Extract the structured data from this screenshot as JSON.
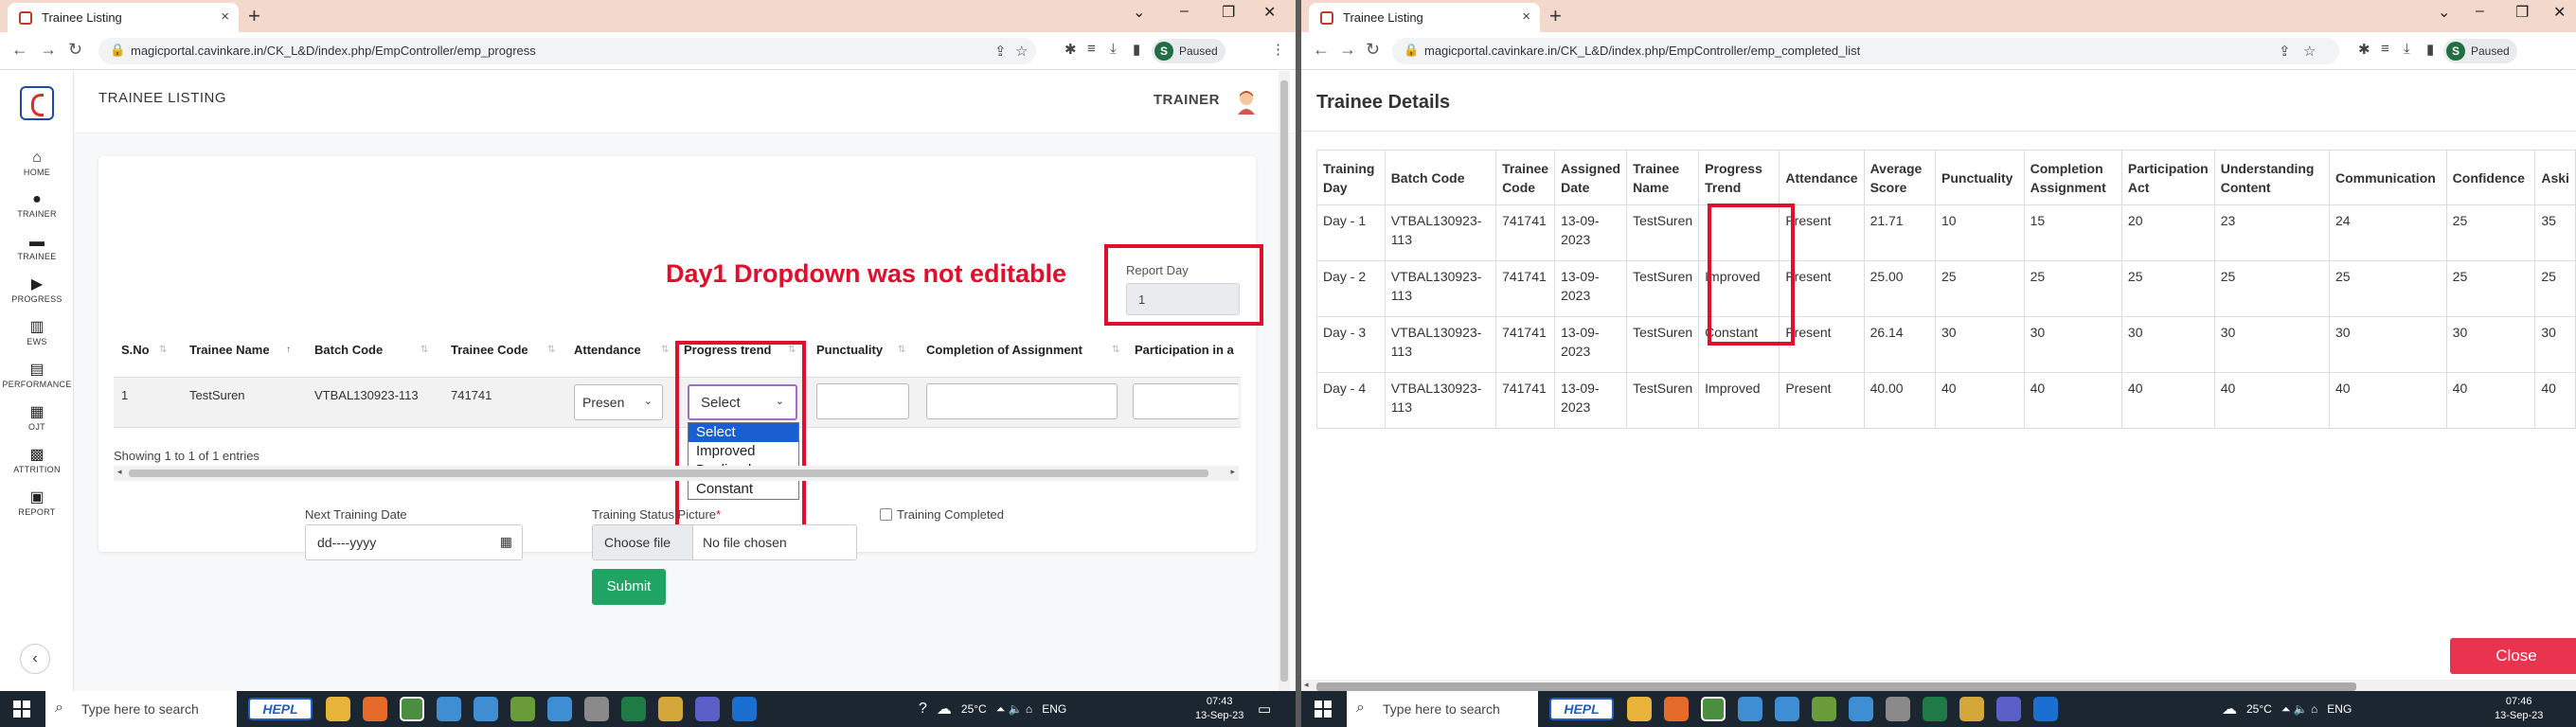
{
  "left": {
    "tab_title": "Trainee Listing",
    "url": "magicportal.cavinkare.in/CK_L&D/index.php/EmpController/emp_progress",
    "profile_initial": "S",
    "profile_status": "Paused",
    "header_role": "TRAINER",
    "page_title": "TRAINEE LISTING",
    "sidebar": [
      {
        "icon": "home-icon",
        "label": "HOME"
      },
      {
        "icon": "trainer-icon",
        "label": "TRAINER"
      },
      {
        "icon": "trainee-icon",
        "label": "TRAINEE"
      },
      {
        "icon": "progress-icon",
        "label": "PROGRESS"
      },
      {
        "icon": "ews-icon",
        "label": "EWS"
      },
      {
        "icon": "performance-icon",
        "label": "PERFORMANCE"
      },
      {
        "icon": "ojt-icon",
        "label": "OJT"
      },
      {
        "icon": "attrition-icon",
        "label": "ATTRITION"
      },
      {
        "icon": "report-icon",
        "label": "REPORT"
      }
    ],
    "annotation": "Day1 Dropdown was not editable",
    "report_day_label": "Report Day",
    "report_day_value": "1",
    "columns": [
      "S.No",
      "Trainee Name",
      "Batch Code",
      "Trainee Code",
      "Attendance",
      "Progress trend",
      "Punctuality",
      "Completion of Assignment",
      "Participation in a"
    ],
    "row": {
      "sno": "1",
      "name": "TestSuren",
      "batch": "VTBAL130923-113",
      "code": "741741",
      "attendance": "Presen"
    },
    "progress_select_value": "Select",
    "progress_options": [
      "Select",
      "Improved",
      "Declined",
      "Constant"
    ],
    "entries_text": "Showing 1 to 1 of 1 entries",
    "next_training_label": "Next Training Date",
    "date_placeholder": "dd----yyyy",
    "status_picture_label": "Training Status Picture",
    "required_mark": "*",
    "choose_file": "Choose file",
    "no_file": "No file chosen",
    "training_completed_label": "Training Completed",
    "submit_label": "Submit"
  },
  "right": {
    "tab_title": "Trainee Listing",
    "url": "magicportal.cavinkare.in/CK_L&D/index.php/EmpController/emp_completed_list",
    "profile_initial": "S",
    "profile_status": "Paused",
    "title": "Trainee Details",
    "columns": [
      "Training Day",
      "Batch Code",
      "Trainee Code",
      "Assigned Date",
      "Trainee Name",
      "Progress Trend",
      "Attendance",
      "Average Score",
      "Punctuality",
      "Completion Assignment",
      "Participation Act",
      "Understanding Content",
      "Communication",
      "Confidence",
      "Aski"
    ],
    "rows": [
      [
        "Day - 1",
        "VTBAL130923-113",
        "741741",
        "13-09-2023",
        "TestSuren",
        "",
        "Present",
        "21.71",
        "10",
        "15",
        "20",
        "23",
        "24",
        "25",
        "35"
      ],
      [
        "Day - 2",
        "VTBAL130923-113",
        "741741",
        "13-09-2023",
        "TestSuren",
        "Improved",
        "Present",
        "25.00",
        "25",
        "25",
        "25",
        "25",
        "25",
        "25",
        "25"
      ],
      [
        "Day - 3",
        "VTBAL130923-113",
        "741741",
        "13-09-2023",
        "TestSuren",
        "Constant",
        "Present",
        "26.14",
        "30",
        "30",
        "30",
        "30",
        "30",
        "30",
        "30"
      ],
      [
        "Day - 4",
        "VTBAL130923-113",
        "741741",
        "13-09-2023",
        "TestSuren",
        "Improved",
        "Present",
        "40.00",
        "40",
        "40",
        "40",
        "40",
        "40",
        "40",
        "40"
      ]
    ],
    "close_label": "Close"
  },
  "taskbar_left": {
    "search_placeholder": "Type here to search",
    "hepl": "HEPL",
    "weather": "25°C",
    "lang": "ENG",
    "time": "07:43",
    "date": "13-Sep-23"
  },
  "taskbar_right": {
    "search_placeholder": "Type here to search",
    "hepl": "HEPL",
    "weather": "25°C",
    "lang": "ENG",
    "time": "07:46",
    "date": "13-Sep-23"
  },
  "colors": {
    "annotation_red": "#e0102b",
    "submit_green": "#1fa463",
    "close_pink": "#e9334f",
    "select_blue": "#1a5fd1"
  }
}
